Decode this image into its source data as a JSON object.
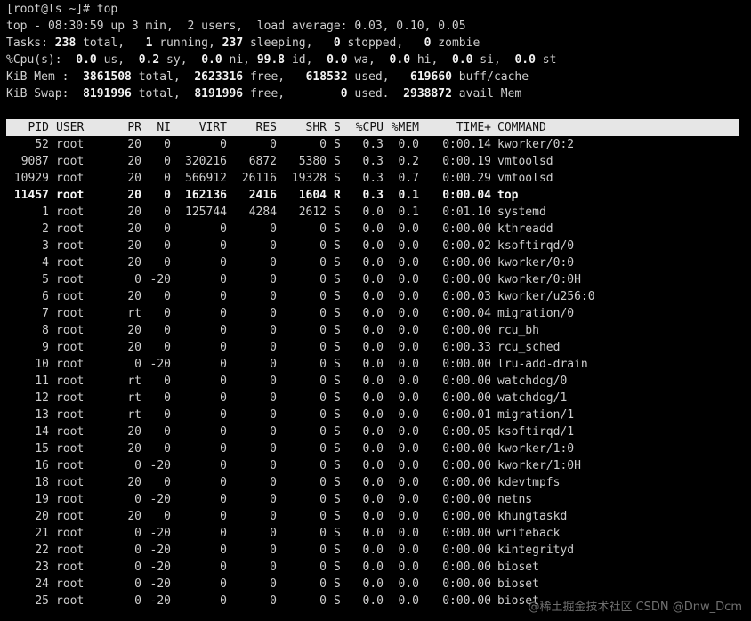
{
  "prompt": "[root@ls ~]# top",
  "summary": {
    "line1": "top - 08:30:59 up 3 min,  2 users,  load average: 0.03, 0.10, 0.05",
    "tasks": {
      "prefix": "Tasks: ",
      "total": "238",
      "t1": " total,   ",
      "running": "1",
      "t2": " running, ",
      "sleeping": "237",
      "t3": " sleeping,   ",
      "stopped": "0",
      "t4": " stopped,   ",
      "zombie": "0",
      "t5": " zombie"
    },
    "cpu": {
      "prefix": "%Cpu(s):  ",
      "us": "0.0",
      "t1": " us,  ",
      "sy": "0.2",
      "t2": " sy,  ",
      "ni": "0.0",
      "t3": " ni, ",
      "id": "99.8",
      "t4": " id,  ",
      "wa": "0.0",
      "t5": " wa,  ",
      "hi": "0.0",
      "t6": " hi,  ",
      "si": "0.0",
      "t7": " si,  ",
      "st": "0.0",
      "t8": " st"
    },
    "mem": {
      "prefix": "KiB Mem :  ",
      "total": "3861508",
      "t1": " total,  ",
      "free": "2623316",
      "t2": " free,   ",
      "used": "618532",
      "t3": " used,   ",
      "buff": "619660",
      "t4": " buff/cache"
    },
    "swap": {
      "prefix": "KiB Swap:  ",
      "total": "8191996",
      "t1": " total,  ",
      "free": "8191996",
      "t2": " free,        ",
      "used": "0",
      "t3": " used.  ",
      "avail": "2938872",
      "t4": " avail Mem"
    }
  },
  "columns": {
    "pid": "PID",
    "user": "USER",
    "pr": "PR",
    "ni": "NI",
    "virt": "VIRT",
    "res": "RES",
    "shr": "SHR",
    "s": "S",
    "cpu": "%CPU",
    "mem": "%MEM",
    "time": "TIME+",
    "command": "COMMAND"
  },
  "processes": [
    {
      "pid": "52",
      "user": "root",
      "pr": "20",
      "ni": "0",
      "virt": "0",
      "res": "0",
      "shr": "0",
      "s": "S",
      "cpu": "0.3",
      "mem": "0.0",
      "time": "0:00.14",
      "command": "kworker/0:2",
      "bold": false
    },
    {
      "pid": "9087",
      "user": "root",
      "pr": "20",
      "ni": "0",
      "virt": "320216",
      "res": "6872",
      "shr": "5380",
      "s": "S",
      "cpu": "0.3",
      "mem": "0.2",
      "time": "0:00.19",
      "command": "vmtoolsd",
      "bold": false
    },
    {
      "pid": "10929",
      "user": "root",
      "pr": "20",
      "ni": "0",
      "virt": "566912",
      "res": "26116",
      "shr": "19328",
      "s": "S",
      "cpu": "0.3",
      "mem": "0.7",
      "time": "0:00.29",
      "command": "vmtoolsd",
      "bold": false
    },
    {
      "pid": "11457",
      "user": "root",
      "pr": "20",
      "ni": "0",
      "virt": "162136",
      "res": "2416",
      "shr": "1604",
      "s": "R",
      "cpu": "0.3",
      "mem": "0.1",
      "time": "0:00.04",
      "command": "top",
      "bold": true
    },
    {
      "pid": "1",
      "user": "root",
      "pr": "20",
      "ni": "0",
      "virt": "125744",
      "res": "4284",
      "shr": "2612",
      "s": "S",
      "cpu": "0.0",
      "mem": "0.1",
      "time": "0:01.10",
      "command": "systemd",
      "bold": false
    },
    {
      "pid": "2",
      "user": "root",
      "pr": "20",
      "ni": "0",
      "virt": "0",
      "res": "0",
      "shr": "0",
      "s": "S",
      "cpu": "0.0",
      "mem": "0.0",
      "time": "0:00.00",
      "command": "kthreadd",
      "bold": false
    },
    {
      "pid": "3",
      "user": "root",
      "pr": "20",
      "ni": "0",
      "virt": "0",
      "res": "0",
      "shr": "0",
      "s": "S",
      "cpu": "0.0",
      "mem": "0.0",
      "time": "0:00.02",
      "command": "ksoftirqd/0",
      "bold": false
    },
    {
      "pid": "4",
      "user": "root",
      "pr": "20",
      "ni": "0",
      "virt": "0",
      "res": "0",
      "shr": "0",
      "s": "S",
      "cpu": "0.0",
      "mem": "0.0",
      "time": "0:00.00",
      "command": "kworker/0:0",
      "bold": false
    },
    {
      "pid": "5",
      "user": "root",
      "pr": "0",
      "ni": "-20",
      "virt": "0",
      "res": "0",
      "shr": "0",
      "s": "S",
      "cpu": "0.0",
      "mem": "0.0",
      "time": "0:00.00",
      "command": "kworker/0:0H",
      "bold": false
    },
    {
      "pid": "6",
      "user": "root",
      "pr": "20",
      "ni": "0",
      "virt": "0",
      "res": "0",
      "shr": "0",
      "s": "S",
      "cpu": "0.0",
      "mem": "0.0",
      "time": "0:00.03",
      "command": "kworker/u256:0",
      "bold": false
    },
    {
      "pid": "7",
      "user": "root",
      "pr": "rt",
      "ni": "0",
      "virt": "0",
      "res": "0",
      "shr": "0",
      "s": "S",
      "cpu": "0.0",
      "mem": "0.0",
      "time": "0:00.04",
      "command": "migration/0",
      "bold": false
    },
    {
      "pid": "8",
      "user": "root",
      "pr": "20",
      "ni": "0",
      "virt": "0",
      "res": "0",
      "shr": "0",
      "s": "S",
      "cpu": "0.0",
      "mem": "0.0",
      "time": "0:00.00",
      "command": "rcu_bh",
      "bold": false
    },
    {
      "pid": "9",
      "user": "root",
      "pr": "20",
      "ni": "0",
      "virt": "0",
      "res": "0",
      "shr": "0",
      "s": "S",
      "cpu": "0.0",
      "mem": "0.0",
      "time": "0:00.33",
      "command": "rcu_sched",
      "bold": false
    },
    {
      "pid": "10",
      "user": "root",
      "pr": "0",
      "ni": "-20",
      "virt": "0",
      "res": "0",
      "shr": "0",
      "s": "S",
      "cpu": "0.0",
      "mem": "0.0",
      "time": "0:00.00",
      "command": "lru-add-drain",
      "bold": false
    },
    {
      "pid": "11",
      "user": "root",
      "pr": "rt",
      "ni": "0",
      "virt": "0",
      "res": "0",
      "shr": "0",
      "s": "S",
      "cpu": "0.0",
      "mem": "0.0",
      "time": "0:00.00",
      "command": "watchdog/0",
      "bold": false
    },
    {
      "pid": "12",
      "user": "root",
      "pr": "rt",
      "ni": "0",
      "virt": "0",
      "res": "0",
      "shr": "0",
      "s": "S",
      "cpu": "0.0",
      "mem": "0.0",
      "time": "0:00.00",
      "command": "watchdog/1",
      "bold": false
    },
    {
      "pid": "13",
      "user": "root",
      "pr": "rt",
      "ni": "0",
      "virt": "0",
      "res": "0",
      "shr": "0",
      "s": "S",
      "cpu": "0.0",
      "mem": "0.0",
      "time": "0:00.01",
      "command": "migration/1",
      "bold": false
    },
    {
      "pid": "14",
      "user": "root",
      "pr": "20",
      "ni": "0",
      "virt": "0",
      "res": "0",
      "shr": "0",
      "s": "S",
      "cpu": "0.0",
      "mem": "0.0",
      "time": "0:00.05",
      "command": "ksoftirqd/1",
      "bold": false
    },
    {
      "pid": "15",
      "user": "root",
      "pr": "20",
      "ni": "0",
      "virt": "0",
      "res": "0",
      "shr": "0",
      "s": "S",
      "cpu": "0.0",
      "mem": "0.0",
      "time": "0:00.00",
      "command": "kworker/1:0",
      "bold": false
    },
    {
      "pid": "16",
      "user": "root",
      "pr": "0",
      "ni": "-20",
      "virt": "0",
      "res": "0",
      "shr": "0",
      "s": "S",
      "cpu": "0.0",
      "mem": "0.0",
      "time": "0:00.00",
      "command": "kworker/1:0H",
      "bold": false
    },
    {
      "pid": "18",
      "user": "root",
      "pr": "20",
      "ni": "0",
      "virt": "0",
      "res": "0",
      "shr": "0",
      "s": "S",
      "cpu": "0.0",
      "mem": "0.0",
      "time": "0:00.00",
      "command": "kdevtmpfs",
      "bold": false
    },
    {
      "pid": "19",
      "user": "root",
      "pr": "0",
      "ni": "-20",
      "virt": "0",
      "res": "0",
      "shr": "0",
      "s": "S",
      "cpu": "0.0",
      "mem": "0.0",
      "time": "0:00.00",
      "command": "netns",
      "bold": false
    },
    {
      "pid": "20",
      "user": "root",
      "pr": "20",
      "ni": "0",
      "virt": "0",
      "res": "0",
      "shr": "0",
      "s": "S",
      "cpu": "0.0",
      "mem": "0.0",
      "time": "0:00.00",
      "command": "khungtaskd",
      "bold": false
    },
    {
      "pid": "21",
      "user": "root",
      "pr": "0",
      "ni": "-20",
      "virt": "0",
      "res": "0",
      "shr": "0",
      "s": "S",
      "cpu": "0.0",
      "mem": "0.0",
      "time": "0:00.00",
      "command": "writeback",
      "bold": false
    },
    {
      "pid": "22",
      "user": "root",
      "pr": "0",
      "ni": "-20",
      "virt": "0",
      "res": "0",
      "shr": "0",
      "s": "S",
      "cpu": "0.0",
      "mem": "0.0",
      "time": "0:00.00",
      "command": "kintegrityd",
      "bold": false
    },
    {
      "pid": "23",
      "user": "root",
      "pr": "0",
      "ni": "-20",
      "virt": "0",
      "res": "0",
      "shr": "0",
      "s": "S",
      "cpu": "0.0",
      "mem": "0.0",
      "time": "0:00.00",
      "command": "bioset",
      "bold": false
    },
    {
      "pid": "24",
      "user": "root",
      "pr": "0",
      "ni": "-20",
      "virt": "0",
      "res": "0",
      "shr": "0",
      "s": "S",
      "cpu": "0.0",
      "mem": "0.0",
      "time": "0:00.00",
      "command": "bioset",
      "bold": false
    },
    {
      "pid": "25",
      "user": "root",
      "pr": "0",
      "ni": "-20",
      "virt": "0",
      "res": "0",
      "shr": "0",
      "s": "S",
      "cpu": "0.0",
      "mem": "0.0",
      "time": "0:00.00",
      "command": "bioset",
      "bold": false
    }
  ],
  "watermark": "@稀土掘金技术社区 CSDN @Dnw_Dcm",
  "colors": {
    "background": "#000000",
    "text": "#cfcfcf",
    "header_bar": "#e6e6e6"
  }
}
